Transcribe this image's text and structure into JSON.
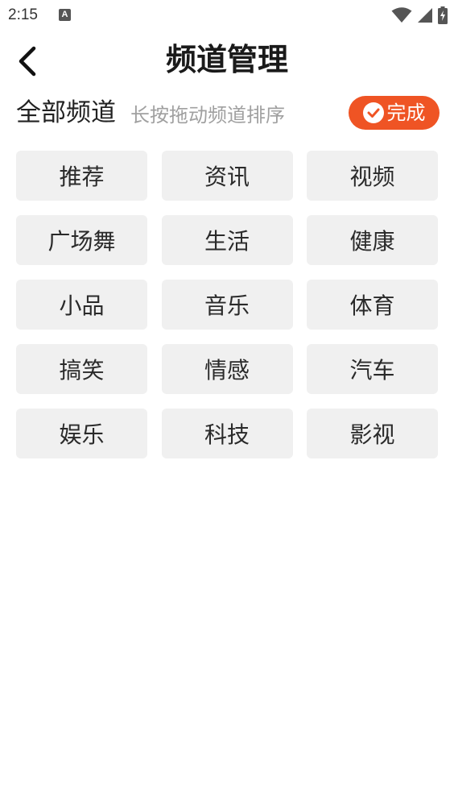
{
  "status_bar": {
    "time": "2:15",
    "notification_letter": "A",
    "icons": [
      "wifi-icon",
      "signal-icon",
      "battery-charging-icon"
    ]
  },
  "header": {
    "title": "频道管理",
    "back_icon": "chevron-left-icon"
  },
  "section": {
    "title": "全部频道",
    "hint": "长按拖动频道排序",
    "done_label": "完成",
    "done_icon": "check-circle-icon"
  },
  "channels": [
    {
      "label": "推荐"
    },
    {
      "label": "资讯"
    },
    {
      "label": "视频"
    },
    {
      "label": "广场舞"
    },
    {
      "label": "生活"
    },
    {
      "label": "健康"
    },
    {
      "label": "小品"
    },
    {
      "label": "音乐"
    },
    {
      "label": "体育"
    },
    {
      "label": "搞笑"
    },
    {
      "label": "情感"
    },
    {
      "label": "汽车"
    },
    {
      "label": "娱乐"
    },
    {
      "label": "科技"
    },
    {
      "label": "影视"
    }
  ],
  "colors": {
    "accent": "#ef5424",
    "chip_bg": "#f0f0f0",
    "hint_text": "#a0a0a0"
  }
}
